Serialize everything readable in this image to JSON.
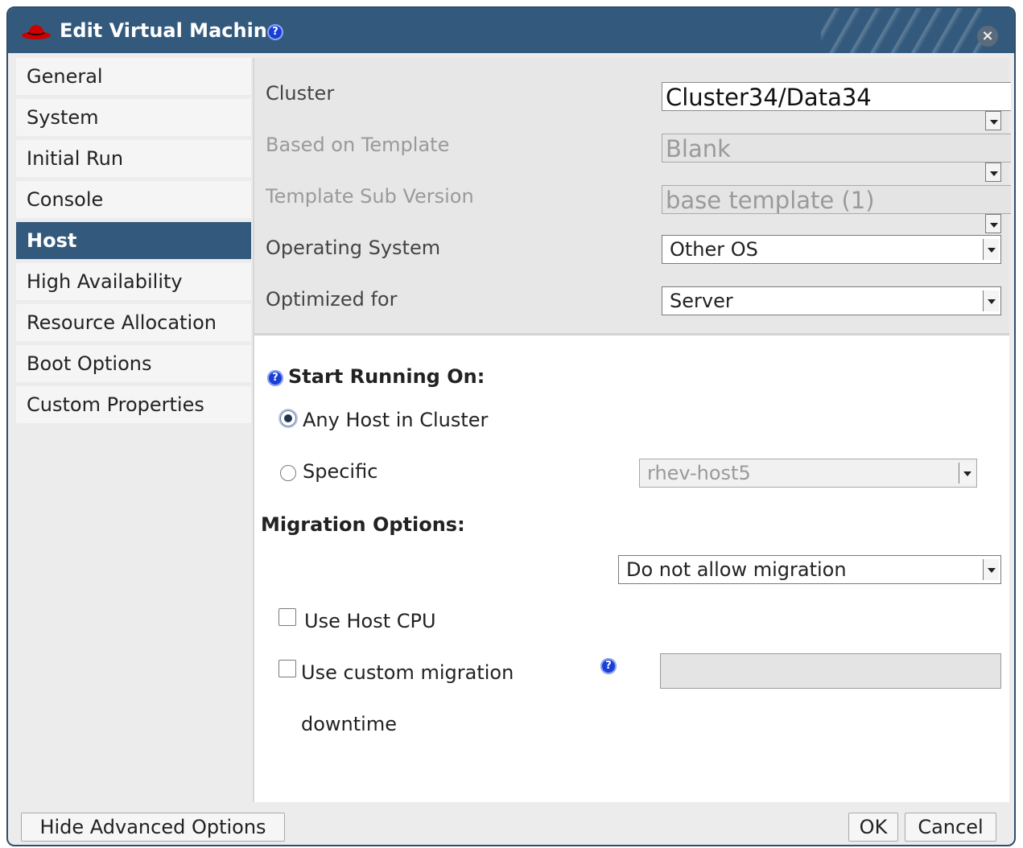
{
  "dialog": {
    "title": "Edit Virtual Machine",
    "help_glyph": "?",
    "close_glyph": "×"
  },
  "sidebar": {
    "items": [
      {
        "label": "General"
      },
      {
        "label": "System"
      },
      {
        "label": "Initial Run"
      },
      {
        "label": "Console"
      },
      {
        "label": "Host",
        "active": true
      },
      {
        "label": "High Availability"
      },
      {
        "label": "Resource Allocation"
      },
      {
        "label": "Boot Options"
      },
      {
        "label": "Custom Properties"
      }
    ]
  },
  "general": {
    "cluster_label": "Cluster",
    "cluster_value": "Cluster34/Data34",
    "template_label": "Based on Template",
    "template_value": "Blank",
    "subversion_label": "Template Sub Version",
    "subversion_value": "base template (1)",
    "os_label": "Operating System",
    "os_value": "Other OS",
    "optimized_label": "Optimized for",
    "optimized_value": "Server"
  },
  "host": {
    "start_running_title": "Start Running On:",
    "any_host_label": "Any Host in Cluster",
    "any_host_selected": true,
    "specific_label": "Specific",
    "specific_selected": false,
    "specific_host_value": "rhev-host5",
    "migration_title": "Migration Options:",
    "migration_value": "Do not allow migration",
    "use_host_cpu_label": "Use Host CPU",
    "use_host_cpu_checked": false,
    "custom_downtime_label_line1": "Use custom migration",
    "custom_downtime_label_line2": "downtime",
    "custom_downtime_checked": false,
    "custom_downtime_value": ""
  },
  "footer": {
    "hide_advanced_label": "Hide Advanced Options",
    "ok_label": "OK",
    "cancel_label": "Cancel"
  },
  "colors": {
    "titlebar": "#335a7d",
    "active_tab": "#335a7d",
    "help_icon": "#1a3fd6",
    "logo_red": "#cc0000"
  }
}
